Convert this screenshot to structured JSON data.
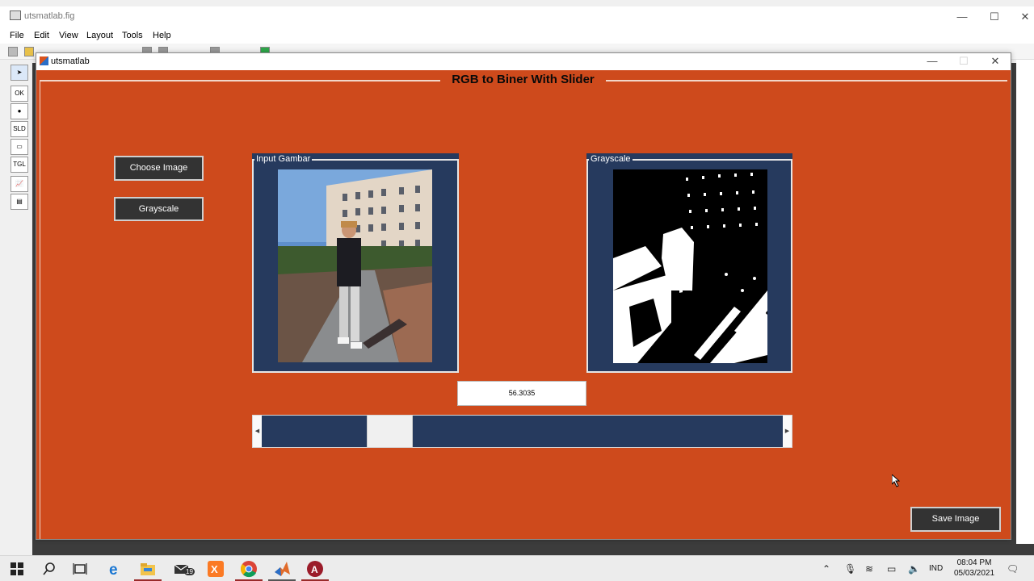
{
  "guide": {
    "title": "utsmatlab.fig",
    "menu": [
      "File",
      "Edit",
      "View",
      "Layout",
      "Tools",
      "Help"
    ],
    "palette": [
      "OK",
      "●",
      "SLD",
      "▭",
      "TGL",
      "📈"
    ]
  },
  "figure": {
    "title": "utsmatlab",
    "main_title": "RGB to Biner With Slider",
    "buttons": {
      "choose_image": "Choose Image",
      "grayscale": "Grayscale",
      "save_image": "Save Image"
    },
    "panels": {
      "input": "Input Gambar",
      "output": "Grayscale"
    },
    "threshold_value": "56.3035",
    "slider": {
      "value_fraction": 0.221
    },
    "colors": {
      "background": "#ce4a1c",
      "panel": "#263a5e",
      "button": "#333333"
    }
  },
  "taskbar": {
    "apps": [
      "start-icon",
      "search-icon",
      "task-view-icon",
      "edge-icon",
      "file-explorer-icon",
      "mail-icon",
      "xampp-icon",
      "chrome-icon",
      "matlab-icon",
      "app-a-icon"
    ],
    "mail_badge": "19",
    "language": "IND",
    "time": "08:04 PM",
    "date": "05/03/2021"
  }
}
